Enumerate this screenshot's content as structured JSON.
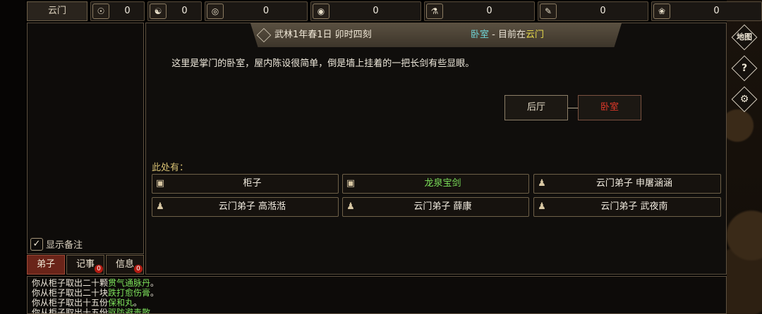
{
  "sect_tab": "云门",
  "resources": [
    {
      "icon": "☉",
      "value": "0"
    },
    {
      "icon": "☯",
      "value": "0"
    },
    {
      "icon": "◎",
      "value": "0"
    },
    {
      "icon": "◉",
      "value": "0"
    },
    {
      "icon": "⚗",
      "value": "0"
    },
    {
      "icon": "✎",
      "value": "0"
    },
    {
      "icon": "❀",
      "value": "0"
    }
  ],
  "header": {
    "date": "武林1年春1日 卯时四刻",
    "room": "卧室",
    "sep": " - 目前在",
    "sect": "云门"
  },
  "description": "这里是掌门的卧室，屋内陈设很简单，倒是墙上挂着的一把长剑有些显眼。",
  "map": {
    "left": "后厅",
    "current": "卧室"
  },
  "here_label": "此处有：",
  "items": [
    {
      "icon": "▣",
      "label": "柜子",
      "highlight": false
    },
    {
      "icon": "▣",
      "label": "龙泉宝剑",
      "highlight": true
    },
    {
      "icon": "♟",
      "label": "云门弟子 申屠涵涵",
      "highlight": false
    },
    {
      "icon": "♟",
      "label": "云门弟子 高湉湉",
      "highlight": false
    },
    {
      "icon": "♟",
      "label": "云门弟子 薛康",
      "highlight": false
    },
    {
      "icon": "♟",
      "label": "云门弟子 武夜南",
      "highlight": false
    }
  ],
  "memo": {
    "check": "✓",
    "label": "显示备注"
  },
  "tabs": [
    {
      "label": "弟子",
      "badge": ""
    },
    {
      "label": "记事",
      "badge": "0"
    },
    {
      "label": "信息",
      "badge": "0"
    }
  ],
  "right_tools": [
    "地图",
    "?",
    "⚙"
  ],
  "log": [
    {
      "pre": "你从柜子取出二十颗",
      "item": "贯气通脉丹",
      "post": "。"
    },
    {
      "pre": "你从柜子取出二十块",
      "item": "跌打愈伤膏",
      "post": "。"
    },
    {
      "pre": "你从柜子取出十五份",
      "item": "保和丸",
      "post": "。"
    },
    {
      "pre": "你从柜子取出十五份",
      "item": "驱防避毒散",
      "post": "。"
    }
  ]
}
